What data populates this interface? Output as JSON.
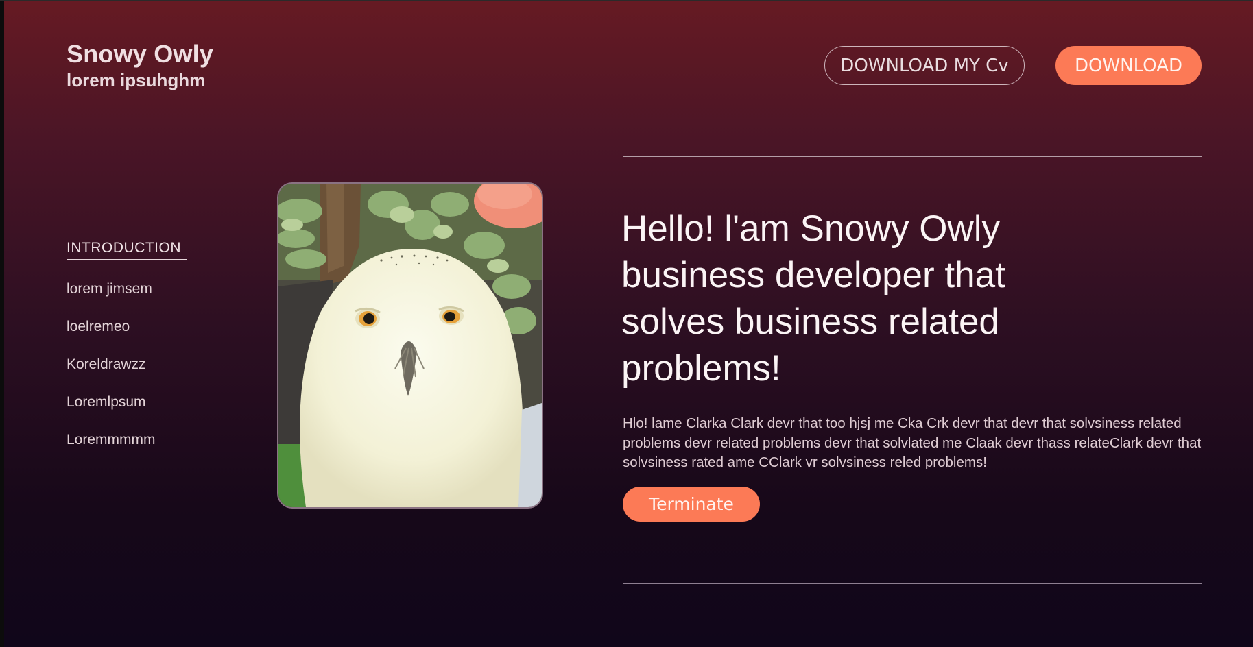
{
  "brand": {
    "title": "Snowy Owly",
    "subtitle": "lorem ipsuhghm"
  },
  "header": {
    "cv_button_label": "DOWNLOAD MY Cv",
    "download_button_label": "DOWNLOAD"
  },
  "side_nav": {
    "active_label": "INTRODUCTION",
    "items": [
      {
        "label": "lorem jimsem"
      },
      {
        "label": "loelremeo"
      },
      {
        "label": "Koreldrawzz"
      },
      {
        "label": "Loremlpsum"
      },
      {
        "label": "Loremmmmm"
      }
    ]
  },
  "hero": {
    "title": "Hello! l'am Snowy Owly business developer that solves business related problems!",
    "body": "Hlo! lame Clarka Clark devr that too hjsj me Cka Crk devr that devr that solvsiness related problems devr related problems devr that solvlated me Claak devr thass relateClark devr that solvsiness rated ame CClark vr solvsiness reled problems!",
    "cta_label": "Terminate"
  },
  "colors": {
    "accent": "#fc7a56",
    "background_top": "#661a23",
    "background_bottom": "#10061a"
  }
}
